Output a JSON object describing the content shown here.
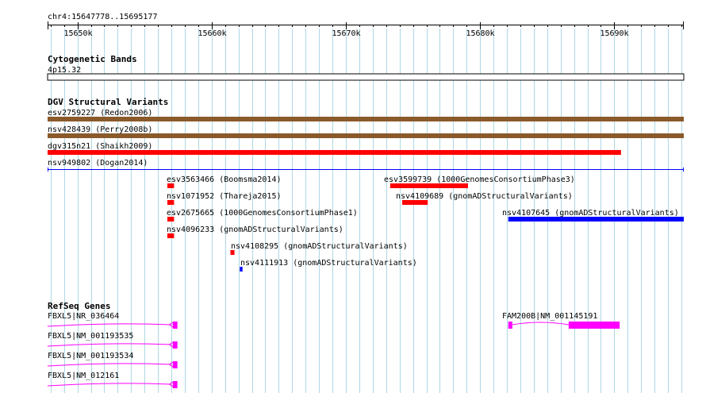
{
  "view": {
    "region": "chr4:15647778..15695177",
    "start": 15647778,
    "end": 15695177
  },
  "ruler": {
    "ticks": [
      {
        "pos": 15650000,
        "label": "15650k"
      },
      {
        "pos": 15660000,
        "label": "15660k"
      },
      {
        "pos": 15670000,
        "label": "15670k"
      },
      {
        "pos": 15680000,
        "label": "15680k"
      },
      {
        "pos": 15690000,
        "label": "15690k"
      }
    ],
    "minor_step": 1000
  },
  "colors": {
    "brown": "#8b5a2b",
    "red": "#ff0000",
    "blue": "#0000ff",
    "magenta": "#ff00ff",
    "grid": "#add8e6",
    "text": "#000000"
  },
  "tracks": {
    "cytoband": {
      "title": "Cytogenetic Bands",
      "band": {
        "label": "4p15.32",
        "start": 15647778,
        "end": 15695177
      }
    },
    "dgv": {
      "title": "DGV Structural Variants",
      "features": [
        {
          "label": "esv2759227 (Redon2006)",
          "start": 15647778,
          "end": 15695177,
          "color": "brown",
          "kind": "bar"
        },
        {
          "label": "nsv428439 (Perry2008b)",
          "start": 15647778,
          "end": 15695177,
          "color": "brown",
          "kind": "bar"
        },
        {
          "label": "dgv315n21 (Shaikh2009)",
          "start": 15647778,
          "end": 15690500,
          "color": "red",
          "kind": "bar"
        },
        {
          "label": "nsv949802 (Dogan2014)",
          "start": 15647778,
          "end": 15695177,
          "color": "blue",
          "kind": "line"
        },
        {
          "label": "esv3563466 (Boomsma2014)",
          "start": 15656700,
          "end": 15657200,
          "color": "red",
          "kind": "bar"
        },
        {
          "label": "esv3599739 (1000GenomesConsortiumPhase3)",
          "start": 15673300,
          "end": 15679100,
          "color": "red",
          "kind": "bar"
        },
        {
          "label": "nsv1071952 (Thareja2015)",
          "start": 15656700,
          "end": 15657200,
          "color": "red",
          "kind": "bar"
        },
        {
          "label": "nsv4109689 (gnomADStructuralVariants)",
          "start": 15674200,
          "end": 15676100,
          "color": "red",
          "kind": "bar"
        },
        {
          "label": "esv2675665 (1000GenomesConsortiumPhase1)",
          "start": 15656700,
          "end": 15657200,
          "color": "red",
          "kind": "bar"
        },
        {
          "label": "nsv4107645 (gnomADStructuralVariants)",
          "start": 15682100,
          "end": 15695177,
          "color": "blue",
          "kind": "bar"
        },
        {
          "label": "nsv4096233 (gnomADStructuralVariants)",
          "start": 15656700,
          "end": 15657200,
          "color": "red",
          "kind": "bar"
        },
        {
          "label": "nsv4108295 (gnomADStructuralVariants)",
          "start": 15661400,
          "end": 15661700,
          "color": "red",
          "kind": "bar"
        },
        {
          "label": "nsv4111913 (gnomADStructuralVariants)",
          "start": 15662100,
          "end": 15662300,
          "color": "blue",
          "kind": "bar"
        }
      ]
    },
    "refseq": {
      "title": "RefSeq Genes",
      "genes": [
        {
          "label": "FBXL5|NR_036464",
          "start": 15647778,
          "end": 15657450,
          "strand": "-",
          "exons": [
            [
              15657100,
              15657450
            ]
          ]
        },
        {
          "label": "FBXL5|NM_001193535",
          "start": 15647778,
          "end": 15657450,
          "strand": "-",
          "exons": [
            [
              15657100,
              15657450
            ]
          ]
        },
        {
          "label": "FBXL5|NM_001193534",
          "start": 15647778,
          "end": 15657450,
          "strand": "-",
          "exons": [
            [
              15657100,
              15657450
            ]
          ]
        },
        {
          "label": "FBXL5|NM_012161",
          "start": 15647778,
          "end": 15657450,
          "strand": "-",
          "exons": [
            [
              15657100,
              15657450
            ]
          ]
        },
        {
          "label": "FAM200B|NM_001145191",
          "start": 15682100,
          "end": 15690400,
          "strand": "+",
          "exons": [
            [
              15682100,
              15682400
            ],
            [
              15686600,
              15690400
            ]
          ]
        }
      ]
    }
  }
}
